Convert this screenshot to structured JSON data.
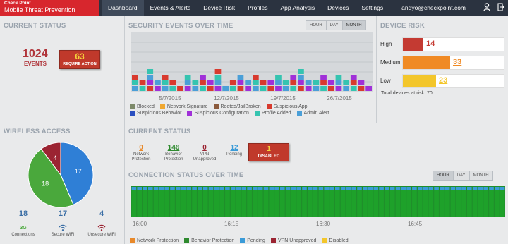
{
  "brand": {
    "line1": "Check Point",
    "line2": "Mobile Threat Prevention"
  },
  "nav": [
    "Dashboard",
    "Events & Alerts",
    "Device Risk",
    "Profiles",
    "App Analysis",
    "Devices",
    "Settings"
  ],
  "user": {
    "email": "andyo@checkpoint.com",
    "icons": [
      "user-icon",
      "logout-icon"
    ]
  },
  "current_status_top": {
    "title": "CURRENT STATUS",
    "events_value": "1024",
    "events_label": "EVENTS",
    "action_value": "63",
    "action_label": "REQUIRE ACTION"
  },
  "security_events": {
    "title": "SECURITY EVENTS OVER TIME",
    "buttons": [
      "HOUR",
      "DAY",
      "MONTH"
    ],
    "x_labels": [
      "5/7/2015",
      "12/7/2015",
      "19/7/2015",
      "26/7/2015"
    ],
    "legend": [
      {
        "label": "Blocked",
        "color": "#7d8a6a"
      },
      {
        "label": "Network Signature",
        "color": "#f0a830"
      },
      {
        "label": "Rooted/JailBroken",
        "color": "#8a5a3c"
      },
      {
        "label": "Suspicious App",
        "color": "#d83a2e"
      },
      {
        "label": "Suspicious Behavior",
        "color": "#2a4fc0"
      },
      {
        "label": "Suspicious Configuration",
        "color": "#a030d8"
      },
      {
        "label": "Profile Added",
        "color": "#35c4b0"
      },
      {
        "label": "Admin Alert",
        "color": "#4a9fd8"
      }
    ]
  },
  "device_risk": {
    "title": "DEVICE RISK",
    "rows": [
      {
        "label": "High",
        "value": "14",
        "color": "#c43a32",
        "fraction": 0.2
      },
      {
        "label": "Medium",
        "value": "33",
        "color": "#f08a24",
        "fraction": 0.47
      },
      {
        "label": "Low",
        "value": "23",
        "color": "#f3c62b",
        "fraction": 0.33
      }
    ],
    "total": "Total devices at risk: 70"
  },
  "wireless": {
    "title": "WIRELESS ACCESS",
    "pie": [
      {
        "label": "17",
        "value": 17,
        "color": "#2f7fd6"
      },
      {
        "label": "18",
        "value": 18,
        "color": "#4aa83c"
      },
      {
        "label": "4",
        "value": 4,
        "color": "#9b2432"
      }
    ],
    "stats": [
      {
        "value": "18",
        "icon": "3G",
        "label": "Connections"
      },
      {
        "value": "17",
        "icon": "wifi-icon",
        "label": "Secure WiFi"
      },
      {
        "value": "4",
        "icon": "wifi-icon",
        "label": "Unsecure WiFi"
      }
    ]
  },
  "current_status_bottom": {
    "title": "CURRENT STATUS",
    "items": [
      {
        "value": "0",
        "label": "Network Protection",
        "color": "#e8892a"
      },
      {
        "value": "146",
        "label": "Behavior Protection",
        "color": "#2e8a2e"
      },
      {
        "value": "0",
        "label": "VPN Unapproved",
        "color": "#9b2432"
      },
      {
        "value": "12",
        "label": "Pending",
        "color": "#3a9bd8"
      }
    ],
    "disabled_value": "1",
    "disabled_label": "DISABLED"
  },
  "connection_status": {
    "title": "CONNECTION STATUS OVER TIME",
    "buttons": [
      "HOUR",
      "DAY",
      "MONTH"
    ],
    "x_labels": [
      "16:00",
      "16:15",
      "16:30",
      "16:45"
    ],
    "legend": [
      {
        "label": "Network Protection",
        "color": "#e8892a"
      },
      {
        "label": "Behavior Protection",
        "color": "#2e8a2e"
      },
      {
        "label": "Pending",
        "color": "#3a9bd8"
      },
      {
        "label": "VPN Unapproved",
        "color": "#9b2432"
      },
      {
        "label": "Disabled",
        "color": "#f3c62b"
      }
    ]
  }
}
